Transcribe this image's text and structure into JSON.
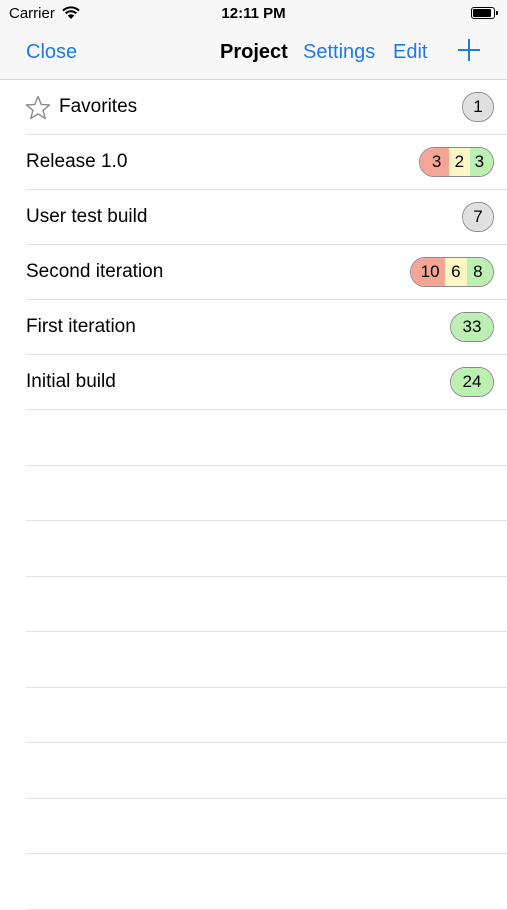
{
  "status_bar": {
    "carrier": "Carrier",
    "time": "12:11 PM"
  },
  "nav": {
    "close_label": "Close",
    "title": "Project",
    "settings_label": "Settings",
    "edit_label": "Edit",
    "add_icon": "plus-icon"
  },
  "rows": [
    {
      "label": "Favorites",
      "icon": "star-icon",
      "badge": [
        {
          "value": "1",
          "color": "#e0e0e0"
        }
      ]
    },
    {
      "label": "Release 1.0",
      "badge": [
        {
          "value": "3",
          "color": "#f4a596"
        },
        {
          "value": "2",
          "color": "#fbf7c4"
        },
        {
          "value": "3",
          "color": "#bcf0b3"
        }
      ]
    },
    {
      "label": "User test build",
      "badge": [
        {
          "value": "7",
          "color": "#e0e0e0"
        }
      ]
    },
    {
      "label": "Second iteration",
      "badge": [
        {
          "value": "10",
          "color": "#f4a596"
        },
        {
          "value": "6",
          "color": "#fbf7c4"
        },
        {
          "value": "8",
          "color": "#bcf0b3"
        }
      ]
    },
    {
      "label": "First iteration",
      "badge": [
        {
          "value": "33",
          "color": "#bcf0b3"
        }
      ]
    },
    {
      "label": "Initial build",
      "badge": [
        {
          "value": "24",
          "color": "#bcf0b3"
        }
      ]
    }
  ],
  "colors": {
    "accent": "#1e7be6"
  }
}
